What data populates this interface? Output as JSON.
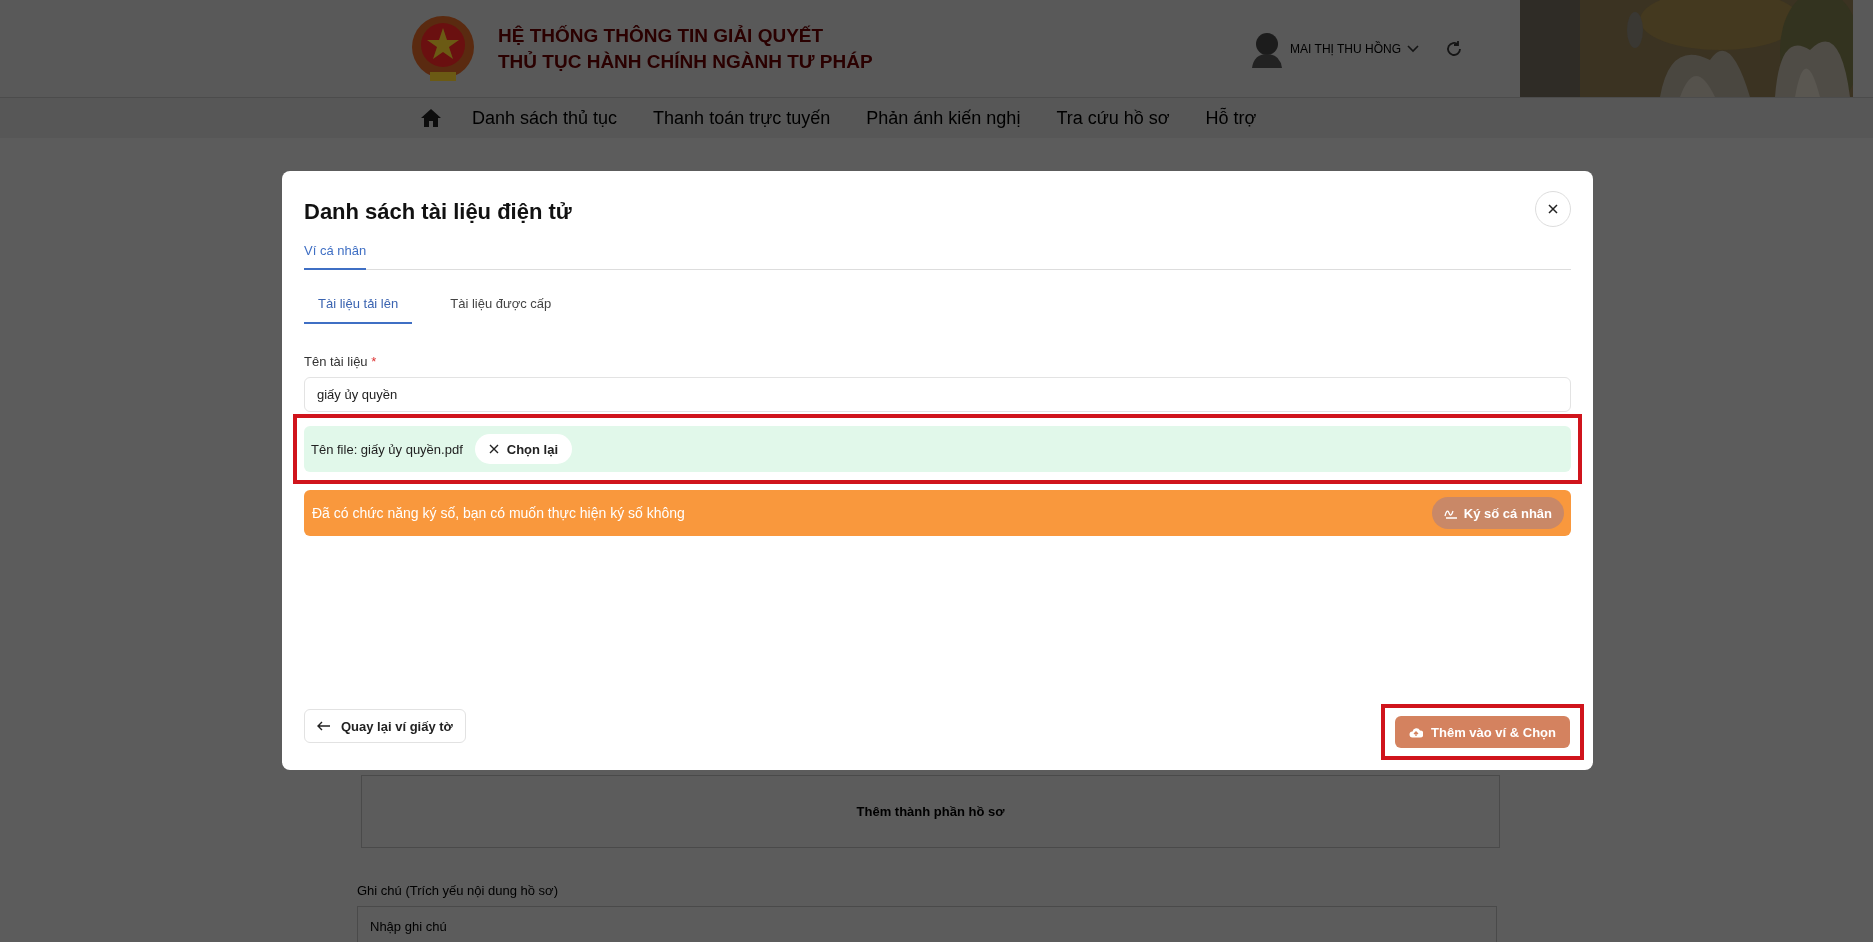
{
  "header": {
    "title_lines": [
      "HỆ THỐNG THÔNG TIN GIẢI QUYẾT",
      "THỦ TỤC HÀNH CHÍNH NGÀNH TƯ PHÁP"
    ],
    "user_name": "MAI THỊ THU HỒNG"
  },
  "nav": {
    "items": [
      "Danh sách thủ tục",
      "Thanh toán trực tuyến",
      "Phản ánh kiến nghị",
      "Tra cứu hồ sơ",
      "Hỗ trợ"
    ]
  },
  "background": {
    "card_text": "Thêm thành phần hồ sơ",
    "note": {
      "label": "Ghi chú (Trích yếu nội dung hồ sơ)",
      "placeholder": "Nhập ghi chú"
    }
  },
  "modal": {
    "title": "Danh sách tài liệu điện tử",
    "wallet_tabs": [
      {
        "label": "Ví cá nhân",
        "selected": true
      }
    ],
    "doc_tabs": [
      {
        "label": "Tài liệu tải lên",
        "selected": true
      },
      {
        "label": "Tài liệu được cấp",
        "selected": false
      }
    ],
    "name_field": {
      "label": "Tên tài liệu",
      "required_mark": "*",
      "value": "giấy ủy quyền"
    },
    "file": {
      "label": "Tên file: giấy ủy quyền.pdf",
      "reselect_button": "Chọn lại"
    },
    "sign_banner": {
      "message": "Đã có chức năng ký số, bạn có muốn thực hiện ký số không",
      "button": "Ký số cá nhân"
    },
    "back_button": "Quay lại ví giấy tờ",
    "submit_button": "Thêm vào ví & Chọn"
  }
}
